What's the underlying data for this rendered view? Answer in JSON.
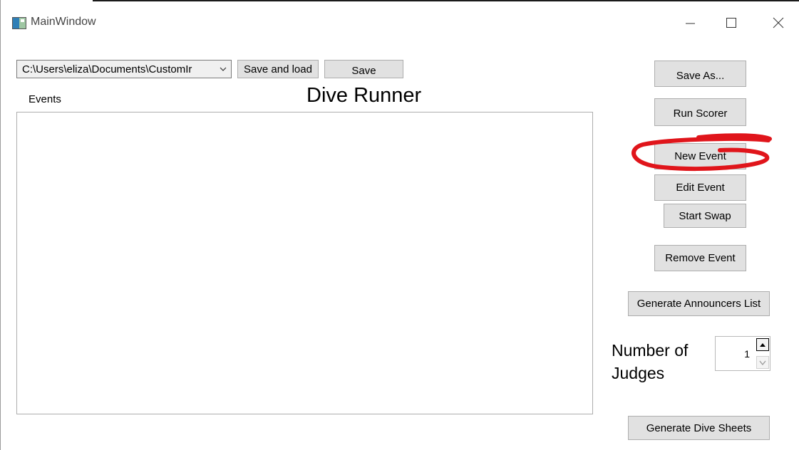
{
  "window": {
    "title": "MainWindow"
  },
  "toolbar": {
    "path_value": "C:\\Users\\eliza\\Documents\\CustomIr",
    "save_and_load_label": "Save and load",
    "save_label": "Save"
  },
  "main": {
    "events_label": "Events",
    "heading": "Dive Runner"
  },
  "side_panel": {
    "save_as_label": "Save As...",
    "run_scorer_label": "Run Scorer",
    "new_event_label": "New Event",
    "edit_event_label": "Edit Event",
    "start_swap_label": "Start Swap",
    "remove_event_label": "Remove Event",
    "generate_announcers_label": "Generate Announcers List",
    "judges_label": "Number of Judges",
    "judges_value": "1",
    "generate_dive_sheets_label": "Generate Dive Sheets"
  },
  "colors": {
    "annotation_stroke": "#e0151b",
    "button_face": "#e1e1e1",
    "button_border": "#adadad"
  },
  "icons": [
    "app-window-icon",
    "minimize-icon",
    "maximize-icon",
    "close-icon",
    "chevron-down-icon",
    "spin-up-icon",
    "spin-down-icon"
  ]
}
